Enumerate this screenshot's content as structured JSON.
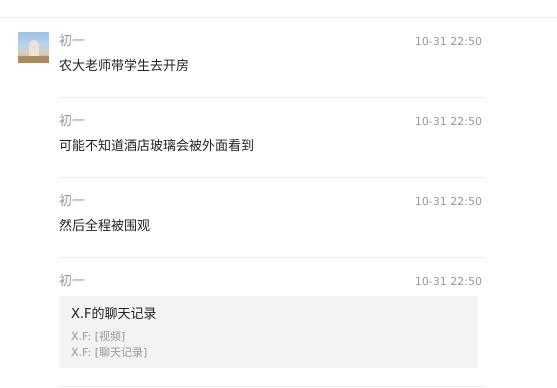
{
  "messages": [
    {
      "sender": "初一",
      "time": "10-31 22:50",
      "text": "农大老师带学生去开房"
    },
    {
      "sender": "初一",
      "time": "10-31 22:50",
      "text": "可能不知道酒店玻璃会被外面看到"
    },
    {
      "sender": "初一",
      "time": "10-31 22:50",
      "text": "然后全程被围观"
    },
    {
      "sender": "初一",
      "time": "10-31 22:50",
      "card": {
        "title": "X.F的聊天记录",
        "lines": [
          "X.F: [视频]",
          "X.F: [聊天记录]"
        ]
      }
    }
  ],
  "avatar_icon": "user-avatar-photo"
}
